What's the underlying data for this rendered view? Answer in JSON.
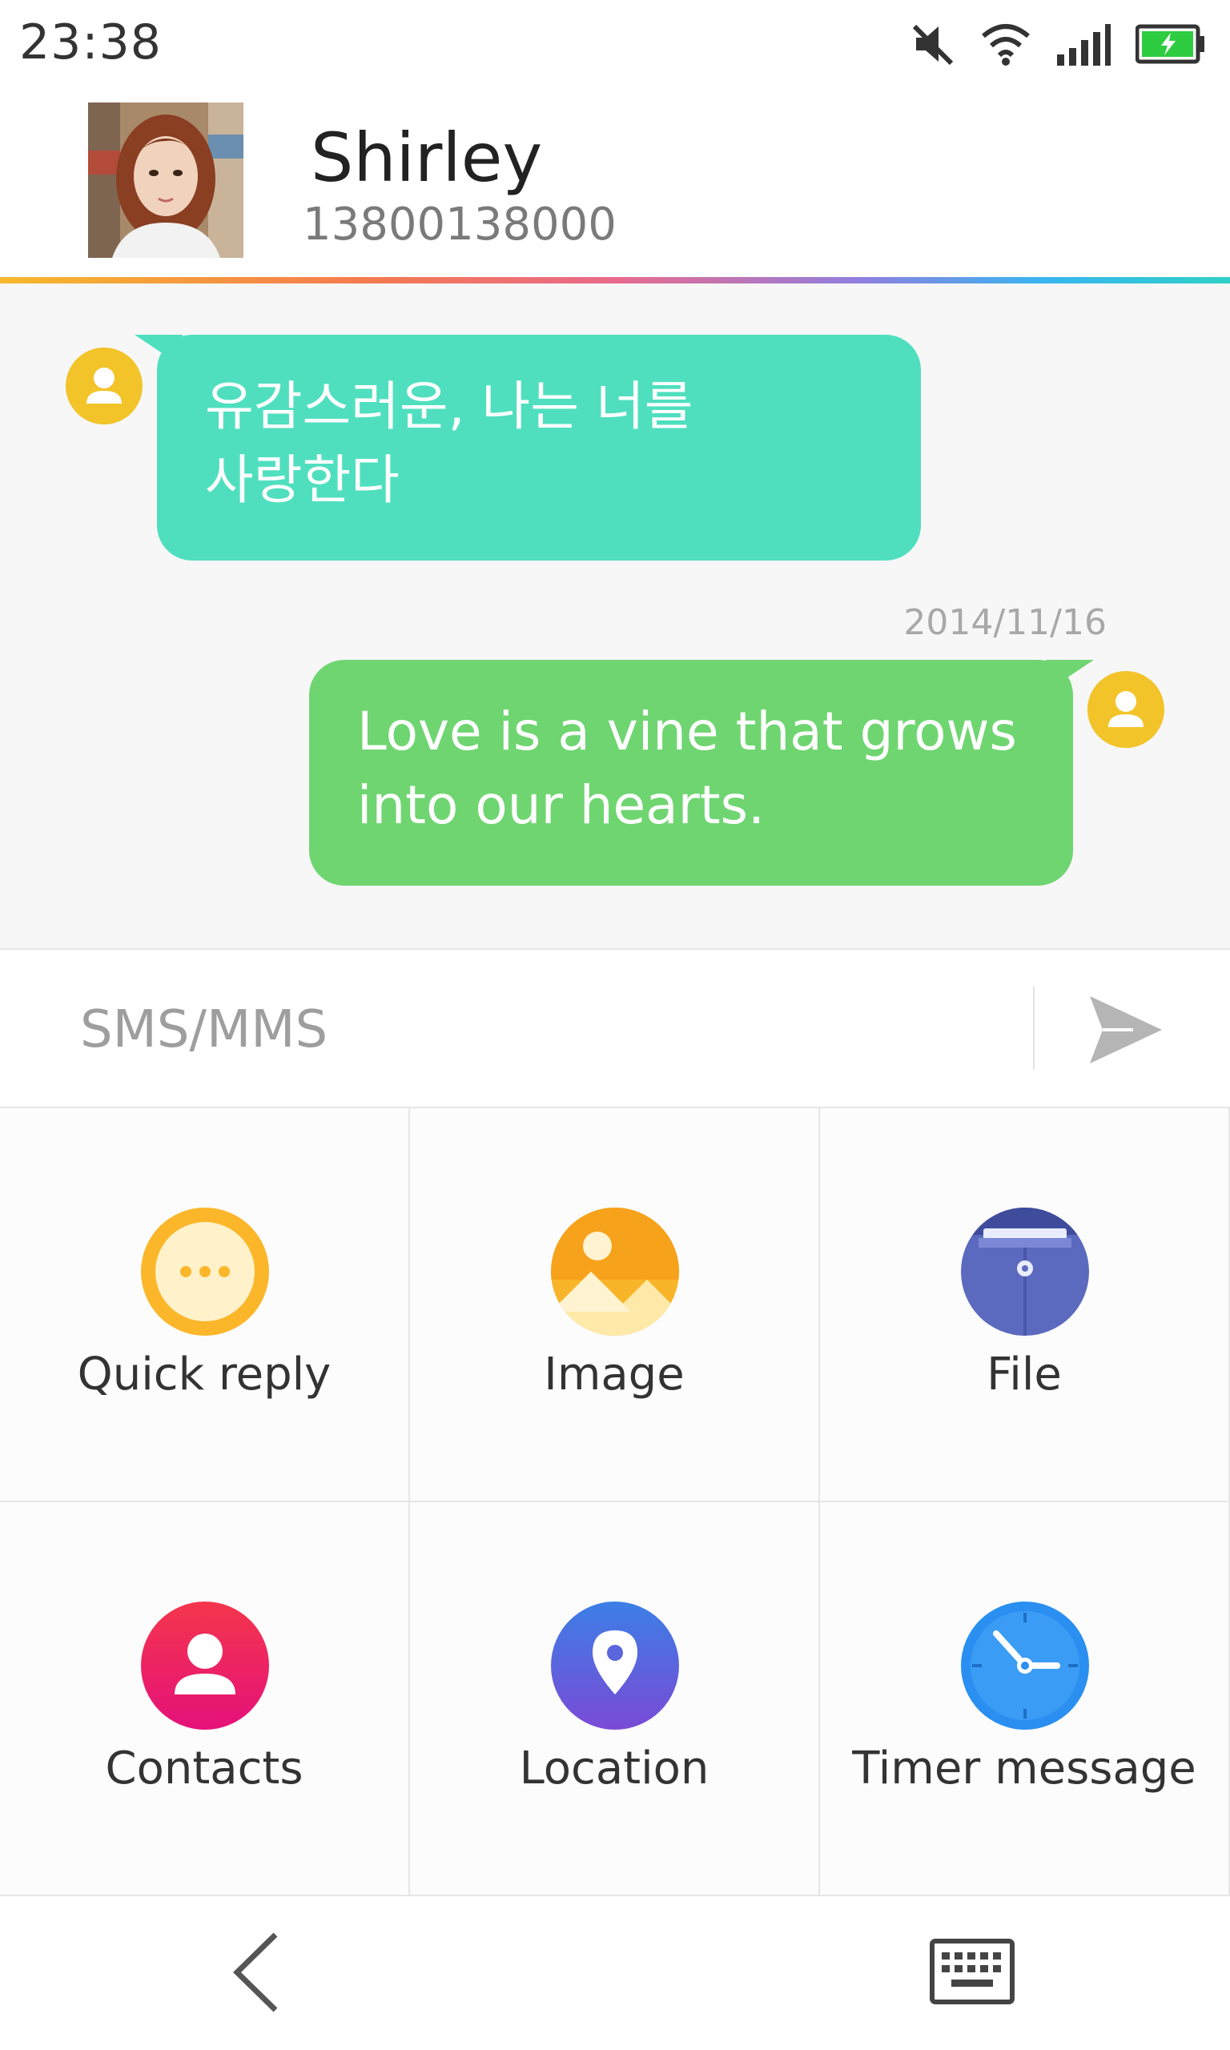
{
  "status_bar": {
    "time": "23:38",
    "icons": [
      "mute-icon",
      "wifi-icon",
      "signal-icon",
      "battery-charging-icon"
    ],
    "battery_color": "#2ecc40"
  },
  "contact": {
    "name": "Shirley",
    "number": "13800138000"
  },
  "conversation": {
    "incoming": {
      "line1": "유감스러운, 나는 너를",
      "line2": "사랑한다",
      "color": "#4fdfbf"
    },
    "timestamp": "2014/11/16",
    "outgoing": {
      "line1": "Love is a vine that grows",
      "line2": "into our hearts.",
      "color": "#6fd571"
    },
    "avatar_color": "#f2c42a"
  },
  "composer": {
    "placeholder": "SMS/MMS",
    "value": ""
  },
  "attachments": [
    {
      "label": "Quick reply",
      "icon": "quick-reply-icon",
      "color": "#fbb62a"
    },
    {
      "label": "Image",
      "icon": "image-icon",
      "color": "#f9b52a"
    },
    {
      "label": "File",
      "icon": "file-icon",
      "color": "#5b6abf"
    },
    {
      "label": "Contacts",
      "icon": "contacts-icon",
      "color": "#ec1c6e"
    },
    {
      "label": "Location",
      "icon": "location-icon",
      "color": "#6a5be0"
    },
    {
      "label": "Timer message",
      "icon": "timer-icon",
      "color": "#2a8ff0"
    }
  ],
  "bottom_bar": {
    "icons": [
      "back-chevron-icon",
      "keyboard-icon"
    ]
  }
}
